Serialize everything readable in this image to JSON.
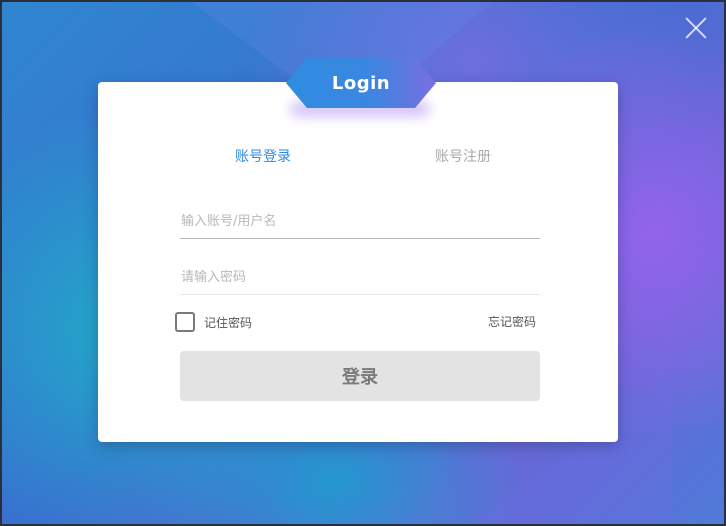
{
  "window": {
    "close_icon": "close-icon"
  },
  "header": {
    "badge_label": "Login"
  },
  "tabs": [
    {
      "label": "账号登录",
      "active": true
    },
    {
      "label": "账号注册",
      "active": false
    }
  ],
  "form": {
    "account": {
      "placeholder": "输入账号/用户名",
      "value": ""
    },
    "password": {
      "placeholder": "请输入密码",
      "value": ""
    },
    "remember_label": "记住密码",
    "remember_checked": false,
    "forgot_label": "忘记密码",
    "submit_label": "登录"
  },
  "colors": {
    "accent": "#2e8ae0",
    "inactive_tab": "#a9a9a9",
    "button_bg": "#e3e3e3"
  }
}
